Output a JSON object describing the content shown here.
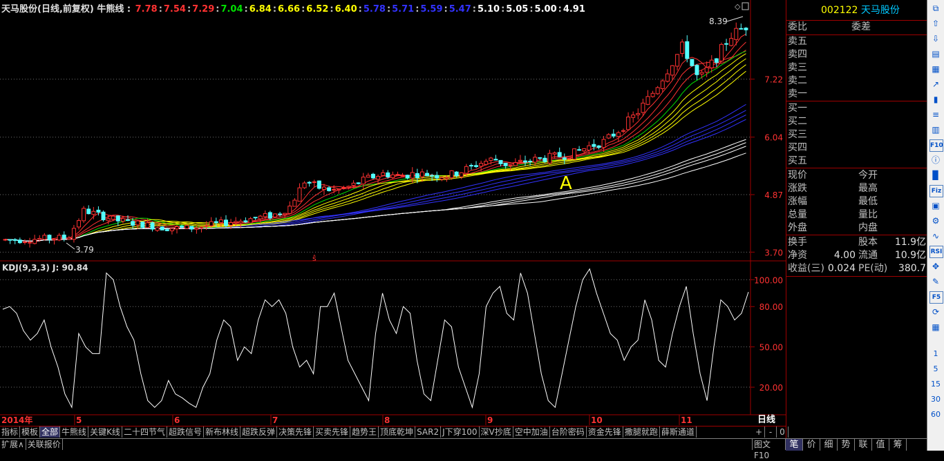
{
  "chart_header": {
    "title": "天马股份(日线,前复权) 牛熊线 :",
    "ma_values": [
      {
        "v": "7.78",
        "color": "#ff3232"
      },
      {
        "v": "7.54",
        "color": "#ff3232"
      },
      {
        "v": "7.29",
        "color": "#ff3232"
      },
      {
        "v": "7.04",
        "color": "#00e000"
      },
      {
        "v": "6.84",
        "color": "#ffff00"
      },
      {
        "v": "6.66",
        "color": "#ffff00"
      },
      {
        "v": "6.52",
        "color": "#ffff00"
      },
      {
        "v": "6.40",
        "color": "#ffff00"
      },
      {
        "v": "5.78",
        "color": "#3232ff"
      },
      {
        "v": "5.71",
        "color": "#3232ff"
      },
      {
        "v": "5.59",
        "color": "#3232ff"
      },
      {
        "v": "5.47",
        "color": "#3232ff"
      },
      {
        "v": "5.10",
        "color": "#ffffff"
      },
      {
        "v": "5.05",
        "color": "#ffffff"
      },
      {
        "v": "5.00",
        "color": "#ffffff"
      },
      {
        "v": "4.91",
        "color": "#ffffff"
      }
    ]
  },
  "chart_data": [
    {
      "type": "candlestick",
      "title": "天马股份(日线,前复权)",
      "ylabel": "",
      "y_ticks": [
        "7.22",
        "6.04",
        "4.87",
        "3.70"
      ],
      "ylim": [
        3.55,
        8.55
      ],
      "annotations": {
        "high_label": "8.39",
        "low_label": "3.79",
        "marker": "A"
      },
      "x_labels": [
        "2014年",
        "5",
        "6",
        "7",
        "8",
        "9",
        "10",
        "11"
      ],
      "period_label": "日线",
      "price_trend_note_points": [
        3.95,
        3.95,
        3.97,
        3.98,
        4.0,
        4.55,
        4.45,
        4.35,
        4.3,
        4.25,
        4.2,
        4.18,
        4.2,
        4.25,
        4.3,
        4.35,
        4.4,
        4.45,
        4.6,
        5.15,
        5.0,
        4.95,
        5.05,
        5.2,
        5.3,
        5.25,
        5.3,
        5.28,
        5.25,
        5.35,
        5.5,
        5.6,
        5.45,
        5.55,
        5.6,
        5.65,
        5.7,
        5.85,
        5.95,
        6.2,
        6.5,
        6.9,
        7.4,
        7.9,
        7.2,
        7.6,
        8.1,
        8.3
      ]
    },
    {
      "type": "line",
      "title": "KDJ(9,3,3) J: 90.84",
      "series": [
        {
          "name": "J",
          "values": [
            78,
            80,
            75,
            62,
            55,
            60,
            70,
            50,
            35,
            15,
            5,
            60,
            50,
            45,
            45,
            105,
            100,
            80,
            65,
            55,
            30,
            10,
            5,
            10,
            25,
            15,
            12,
            8,
            5,
            20,
            30,
            55,
            70,
            65,
            40,
            50,
            45,
            70,
            85,
            80,
            85,
            75,
            50,
            35,
            40,
            30,
            80,
            80,
            90,
            65,
            40,
            30,
            20,
            10,
            60,
            90,
            70,
            60,
            80,
            75,
            40,
            15,
            10,
            40,
            70,
            65,
            35,
            20,
            5,
            30,
            80,
            90,
            95,
            75,
            70,
            105,
            90,
            60,
            30,
            10,
            5,
            30,
            55,
            80,
            100,
            108,
            90,
            75,
            60,
            55,
            40,
            50,
            55,
            85,
            70,
            40,
            35,
            60,
            80,
            95,
            60,
            30,
            10,
            50,
            85,
            80,
            70,
            75,
            90.84
          ]
        }
      ],
      "y_ticks": [
        "100.00",
        "80.00",
        "50.00",
        "20.00"
      ],
      "ylim": [
        0,
        113
      ]
    }
  ],
  "quote_panel": {
    "code": "002122",
    "name": "天马股份",
    "weibi": "委比",
    "weicha": "委差",
    "sell": [
      "卖五",
      "卖四",
      "卖三",
      "卖二",
      "卖一"
    ],
    "buy": [
      "买一",
      "买二",
      "买三",
      "买四",
      "买五"
    ],
    "stats_left": [
      "现价",
      "涨跌",
      "涨幅",
      "总量",
      "外盘"
    ],
    "stats_right": [
      "今开",
      "最高",
      "最低",
      "量比",
      "内盘"
    ],
    "fundamentals": [
      {
        "label": "换手",
        "value": "",
        "label2": "股本",
        "value2": "11.9亿"
      },
      {
        "label": "净资",
        "value": "4.00",
        "label2": "流通",
        "value2": "10.9亿"
      },
      {
        "label": "收益(三)",
        "value": "0.024",
        "label2": "PE(动)",
        "value2": "380.7"
      }
    ]
  },
  "toolbar": {
    "icons": [
      "restore-icon",
      "up-arrow-icon",
      "down-arrow-icon",
      "chart-icon",
      "grid-icon",
      "line-chart-icon",
      "candle-icon",
      "list-icon",
      "table-icon",
      "f10-icon",
      "info-icon",
      "bar-icon",
      "fiz-icon",
      "image-icon",
      "settings-icon",
      "wave-icon",
      "rsi-icon",
      "move-icon",
      "pen-icon",
      "f5-icon",
      "refresh-icon",
      "tile-icon"
    ],
    "icon_labels": {
      "f10-icon": "F10",
      "fiz-icon": "Fiz",
      "rsi-icon": "RSI",
      "f5-icon": "F5"
    },
    "numbers": [
      "1",
      "5",
      "15",
      "30",
      "60"
    ]
  },
  "tabs": [
    "指标",
    "模板",
    "全部",
    "牛熊线",
    "关键K线",
    "二十四节气",
    "超跌信号",
    "新布林线",
    "超跌反弹",
    "决策先锋",
    "买卖先锋",
    "趋势王",
    "顶底乾坤",
    "SAR2",
    "J下穿100",
    "深V抄底",
    "空中加油",
    "台阶密码",
    "资金先锋",
    "撒腿就跑",
    "薛斯通道"
  ],
  "active_tab": "全部",
  "tab_controls": [
    "+",
    "-",
    "0"
  ],
  "bottom_tabs": [
    "扩展∧",
    "关联报价"
  ],
  "bottom_right": "图文F10",
  "panel_tabs": [
    "笔",
    "价",
    "细",
    "势",
    "联",
    "值",
    "筹"
  ],
  "active_panel_tab": "笔"
}
